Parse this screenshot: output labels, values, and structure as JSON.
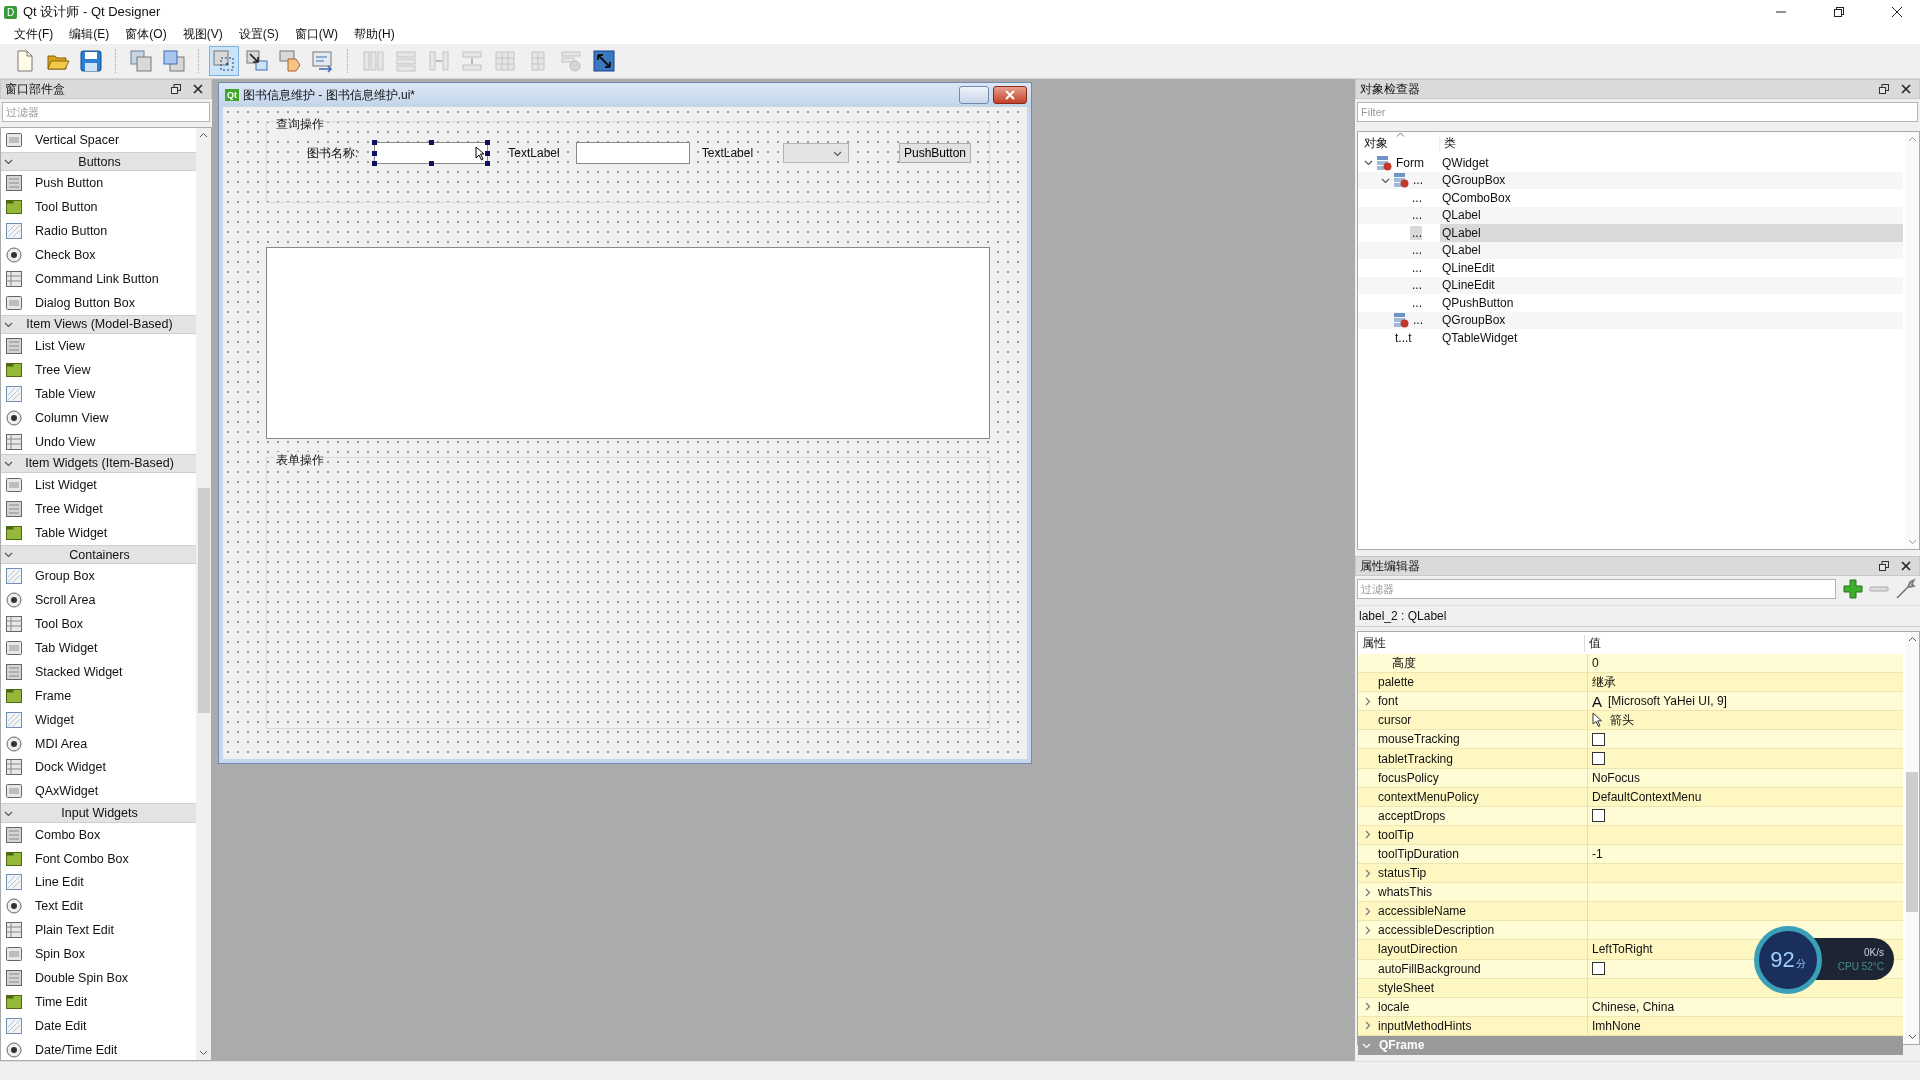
{
  "window": {
    "title": "Qt 设计师 - Qt Designer",
    "logo_text": "D"
  },
  "menu": [
    {
      "label": "文件(F)"
    },
    {
      "label": "编辑(E)"
    },
    {
      "label": "窗体(O)"
    },
    {
      "label": "视图(V)"
    },
    {
      "label": "设置(S)"
    },
    {
      "label": "窗口(W)"
    },
    {
      "label": "帮助(H)"
    }
  ],
  "toolbar": [
    {
      "kind": "new",
      "selected": false,
      "disabled": false
    },
    {
      "kind": "open",
      "selected": false,
      "disabled": false
    },
    {
      "kind": "save",
      "selected": false,
      "disabled": false
    },
    {
      "kind": "separator"
    },
    {
      "kind": "raise",
      "selected": false,
      "disabled": false
    },
    {
      "kind": "lower",
      "selected": false,
      "disabled": false
    },
    {
      "kind": "separator"
    },
    {
      "kind": "edit_widgets",
      "selected": true,
      "disabled": false
    },
    {
      "kind": "edit_signals",
      "selected": false,
      "disabled": false
    },
    {
      "kind": "edit_buddies",
      "selected": false,
      "disabled": false
    },
    {
      "kind": "edit_tab_order",
      "selected": false,
      "disabled": false
    },
    {
      "kind": "separator"
    },
    {
      "kind": "layout_h",
      "selected": false,
      "disabled": true
    },
    {
      "kind": "layout_v",
      "selected": false,
      "disabled": true
    },
    {
      "kind": "splitter_h",
      "selected": false,
      "disabled": true
    },
    {
      "kind": "splitter_v",
      "selected": false,
      "disabled": true
    },
    {
      "kind": "grid",
      "selected": false,
      "disabled": true
    },
    {
      "kind": "form_layout",
      "selected": false,
      "disabled": true
    },
    {
      "kind": "break_layout",
      "selected": false,
      "disabled": true
    },
    {
      "kind": "adjust_size",
      "selected": false,
      "disabled": false
    }
  ],
  "widget_box": {
    "title": "窗口部件盒",
    "filter": {
      "placeholder": "过滤器"
    },
    "list": [
      {
        "kind": "widget",
        "label": "Vertical Spacer"
      },
      {
        "kind": "category",
        "label": "Buttons",
        "expanded": true,
        "children": [
          {
            "kind": "widget",
            "label": "Push Button"
          },
          {
            "kind": "widget",
            "label": "Tool Button"
          },
          {
            "kind": "widget",
            "label": "Radio Button"
          },
          {
            "kind": "widget",
            "label": "Check Box"
          },
          {
            "kind": "widget",
            "label": "Command Link Button"
          },
          {
            "kind": "widget",
            "label": "Dialog Button Box"
          }
        ]
      },
      {
        "kind": "category",
        "label": "Item Views (Model-Based)",
        "expanded": true,
        "children": [
          {
            "kind": "widget",
            "label": "List View"
          },
          {
            "kind": "widget",
            "label": "Tree View"
          },
          {
            "kind": "widget",
            "label": "Table View"
          },
          {
            "kind": "widget",
            "label": "Column View"
          },
          {
            "kind": "widget",
            "label": "Undo View"
          }
        ]
      },
      {
        "kind": "category",
        "label": "Item Widgets (Item-Based)",
        "expanded": true,
        "children": [
          {
            "kind": "widget",
            "label": "List Widget"
          },
          {
            "kind": "widget",
            "label": "Tree Widget"
          },
          {
            "kind": "widget",
            "label": "Table Widget"
          }
        ]
      },
      {
        "kind": "category",
        "label": "Containers",
        "expanded": true,
        "children": [
          {
            "kind": "widget",
            "label": "Group Box"
          },
          {
            "kind": "widget",
            "label": "Scroll Area"
          },
          {
            "kind": "widget",
            "label": "Tool Box"
          },
          {
            "kind": "widget",
            "label": "Tab Widget"
          },
          {
            "kind": "widget",
            "label": "Stacked Widget"
          },
          {
            "kind": "widget",
            "label": "Frame"
          },
          {
            "kind": "widget",
            "label": "Widget"
          },
          {
            "kind": "widget",
            "label": "MDI Area"
          },
          {
            "kind": "widget",
            "label": "Dock Widget"
          },
          {
            "kind": "widget",
            "label": "QAxWidget"
          }
        ]
      },
      {
        "kind": "category",
        "label": "Input Widgets",
        "expanded": true,
        "children": [
          {
            "kind": "widget",
            "label": "Combo Box"
          },
          {
            "kind": "widget",
            "label": "Font Combo Box"
          },
          {
            "kind": "widget",
            "label": "Line Edit"
          },
          {
            "kind": "widget",
            "label": "Text Edit"
          },
          {
            "kind": "widget",
            "label": "Plain Text Edit"
          },
          {
            "kind": "widget",
            "label": "Spin Box"
          },
          {
            "kind": "widget",
            "label": "Double Spin Box"
          },
          {
            "kind": "widget",
            "label": "Time Edit"
          },
          {
            "kind": "widget",
            "label": "Date Edit"
          },
          {
            "kind": "widget",
            "label": "Date/Time Edit"
          }
        ]
      }
    ]
  },
  "form_window": {
    "title": "图书信息维护 - 图书信息维护.ui*",
    "logo_text": "Qt",
    "query_group": {
      "title": "查询操作",
      "controls": [
        {
          "kind": "label",
          "text": "图书名称:"
        },
        {
          "kind": "line_edit",
          "selected": true
        },
        {
          "kind": "label",
          "text": "TextLabel"
        },
        {
          "kind": "line_edit",
          "selected": false
        },
        {
          "kind": "label",
          "text": "TextLabel"
        },
        {
          "kind": "combo_box"
        },
        {
          "kind": "push_button",
          "text": "PushButton"
        }
      ]
    },
    "form_group": {
      "title": "表单操作"
    }
  },
  "object_inspector": {
    "title": "对象检查器",
    "filter": {
      "placeholder": "Filter"
    },
    "columns": [
      "对象",
      "类"
    ],
    "tree": [
      {
        "kind": "container",
        "object": "Form",
        "class": "QWidget",
        "expanded": true,
        "selected": false,
        "children": [
          {
            "kind": "container",
            "object": "...",
            "class": "QGroupBox",
            "expanded": true,
            "selected": false,
            "children": [
              {
                "kind": "widget",
                "object": "...",
                "class": "QComboBox",
                "selected": false
              },
              {
                "kind": "widget",
                "object": "...",
                "class": "QLabel",
                "selected": false
              },
              {
                "kind": "widget",
                "object": "...",
                "class": "QLabel",
                "selected": true
              },
              {
                "kind": "widget",
                "object": "...",
                "class": "QLabel",
                "selected": false
              },
              {
                "kind": "widget",
                "object": "...",
                "class": "QLineEdit",
                "selected": false
              },
              {
                "kind": "widget",
                "object": "...",
                "class": "QLineEdit",
                "selected": false
              },
              {
                "kind": "widget",
                "object": "...",
                "class": "QPushButton",
                "selected": false
              }
            ]
          },
          {
            "kind": "container",
            "object": "...",
            "class": "QGroupBox",
            "selected": false
          },
          {
            "kind": "widget",
            "object": "t...t",
            "class": "QTableWidget",
            "selected": false
          }
        ]
      }
    ]
  },
  "property_editor": {
    "title": "属性编辑器",
    "filter": {
      "placeholder": "过滤器"
    },
    "object_label": "label_2 : QLabel",
    "columns": [
      "属性",
      "值"
    ],
    "rows": [
      {
        "kind": "sub",
        "name": "高度",
        "value": "0",
        "expandable": false
      },
      {
        "kind": "text",
        "name": "palette",
        "value": "继承",
        "expandable": false
      },
      {
        "kind": "font",
        "name": "font",
        "preview": "A",
        "value": "[Microsoft YaHei UI, 9]",
        "expandable": true
      },
      {
        "kind": "cursor",
        "name": "cursor",
        "value": "箭头",
        "expandable": false
      },
      {
        "kind": "checkbox",
        "name": "mouseTracking",
        "checked": false,
        "expandable": false
      },
      {
        "kind": "checkbox",
        "name": "tabletTracking",
        "checked": false,
        "expandable": false
      },
      {
        "kind": "text",
        "name": "focusPolicy",
        "value": "NoFocus",
        "expandable": false
      },
      {
        "kind": "text",
        "name": "contextMenuPolicy",
        "value": "DefaultContextMenu",
        "expandable": false
      },
      {
        "kind": "checkbox",
        "name": "acceptDrops",
        "checked": false,
        "expandable": false
      },
      {
        "kind": "text",
        "name": "toolTip",
        "expandable": true
      },
      {
        "kind": "text",
        "name": "toolTipDuration",
        "value": "-1",
        "expandable": false
      },
      {
        "kind": "text",
        "name": "statusTip",
        "expandable": true
      },
      {
        "kind": "text",
        "name": "whatsThis",
        "expandable": true
      },
      {
        "kind": "text",
        "name": "accessibleName",
        "expandable": true
      },
      {
        "kind": "text",
        "name": "accessibleDescription",
        "expandable": true
      },
      {
        "kind": "text",
        "name": "layoutDirection",
        "value": "LeftToRight",
        "expandable": false
      },
      {
        "kind": "checkbox",
        "name": "autoFillBackground",
        "checked": false,
        "expandable": false
      },
      {
        "kind": "text",
        "name": "styleSheet",
        "expandable": false
      },
      {
        "kind": "text",
        "name": "locale",
        "value": "Chinese, China",
        "expandable": true
      },
      {
        "kind": "text",
        "name": "inputMethodHints",
        "value": "ImhNone",
        "expandable": true
      },
      {
        "kind": "section",
        "name": "QFrame",
        "expanded": true
      }
    ]
  },
  "system_monitor": {
    "score": "92",
    "score_unit": "分",
    "network": "0K/s",
    "cpu": "CPU 52°C"
  }
}
